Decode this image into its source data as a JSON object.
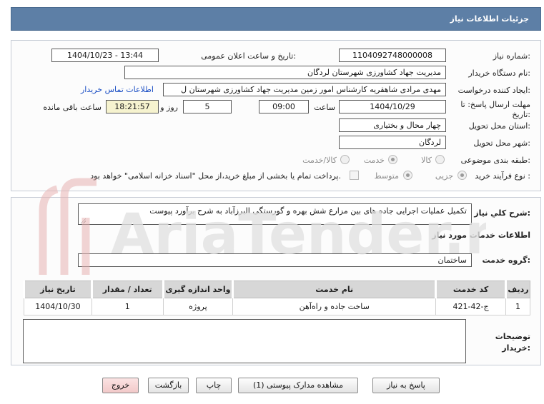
{
  "header": {
    "title": "جزئیات اطلاعات نیاز"
  },
  "form": {
    "need_number_label": "شماره نیاز:",
    "need_number": "1104092748000008",
    "announce_label": "تاریخ و ساعت اعلان عمومی:",
    "announce_value": "1404/10/23 - 13:44",
    "buyer_org_label": "نام دستگاه خریدار:",
    "buyer_org": "مدیریت جهاد کشاورزی شهرستان لردگان",
    "creator_label": "ایجاد کننده درخواست:",
    "creator": "مهدی مرادی شاهقریه کارشناس امور زمین مدیریت جهاد کشاورزی شهرستان ل",
    "contact_link": "اطلاعات تماس خریدار",
    "deadline_label": "مهلت ارسال پاسخ: تا",
    "deadline_label2": "تاریخ:",
    "deadline_date": "1404/10/29",
    "time_label": "ساعت",
    "deadline_time": "09:00",
    "days_value": "5",
    "days_label": "روز و",
    "remaining_time": "18:21:57",
    "remaining_label": "ساعت باقی مانده",
    "province_label": "استان محل تحویل:",
    "province": "چهار محال و بختیاری",
    "city_label": "شهر محل تحویل:",
    "city": "لردگان",
    "category_label": "طبقه بندی موضوعی:",
    "category_options": [
      "کالا",
      "خدمت",
      "کالا/خدمت"
    ],
    "category_selected": 1,
    "process_label": "نوع فرآیند خرید :",
    "process_options": [
      "جزیی",
      "متوسط"
    ],
    "process_selected": 0,
    "payment_text": "پرداخت تمام یا بخشی از مبلغ خرید،از محل \"اسناد خزانه اسلامی\" خواهد بود."
  },
  "details": {
    "summary_label": "شرح کلي نياز:",
    "summary": "تکمیل عملیات اجرایی جاده های بین مزارع شش بهره و گورستگی البرزآباد به شرح برآورد پیوست",
    "services_title": "اطلاعات خدمات مورد نیاز",
    "service_group_label": "گروه خدمت:",
    "service_group": "ساختمان",
    "table": {
      "headers": [
        "ردیف",
        "کد خدمت",
        "نام خدمت",
        "واحد اندازه گیری",
        "تعداد / مقدار",
        "تاریخ نیاز"
      ],
      "rows": [
        [
          "1",
          "ج-42-421",
          "ساخت جاده و راه‌آهن",
          "پروژه",
          "1",
          "1404/10/30"
        ]
      ]
    },
    "buyer_notes_label": "توضیحات",
    "buyer_notes_label2": "خریدار:",
    "buyer_notes": ""
  },
  "buttons": {
    "reply": "پاسخ به نیاز",
    "attachments": "مشاهده مدارک پیوستی (1)",
    "print": "چاپ",
    "back": "بازگشت",
    "exit": "خروج"
  },
  "colors": {
    "titlebar": "#5d7fa6",
    "link": "#1a4ec4",
    "remaining_bg": "#f6f3cf",
    "exit_bg": "#f2c9c9"
  },
  "watermark": {
    "text": "AriaTender.neT"
  }
}
